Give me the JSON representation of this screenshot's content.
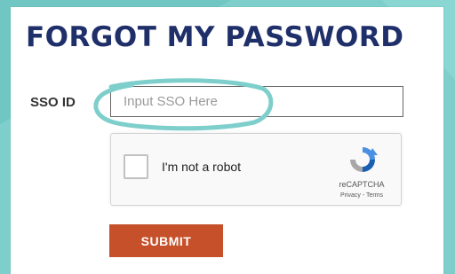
{
  "page": {
    "title": "FORGOT MY PASSWORD",
    "background_color": "#7ecfcc",
    "title_color": "#1f2f6a"
  },
  "form": {
    "sso_label": "SSO ID",
    "sso_input": {
      "placeholder": "Input SSO Here",
      "value": ""
    },
    "annotation_color": "#7ecfcc"
  },
  "captcha": {
    "checkbox_label": "I'm not a robot",
    "checked": false,
    "brand": "reCAPTCHA",
    "links": "Privacy - Terms",
    "logo_icon": "recaptcha-icon"
  },
  "submit": {
    "label": "SUBMIT",
    "color": "#c6502a"
  }
}
